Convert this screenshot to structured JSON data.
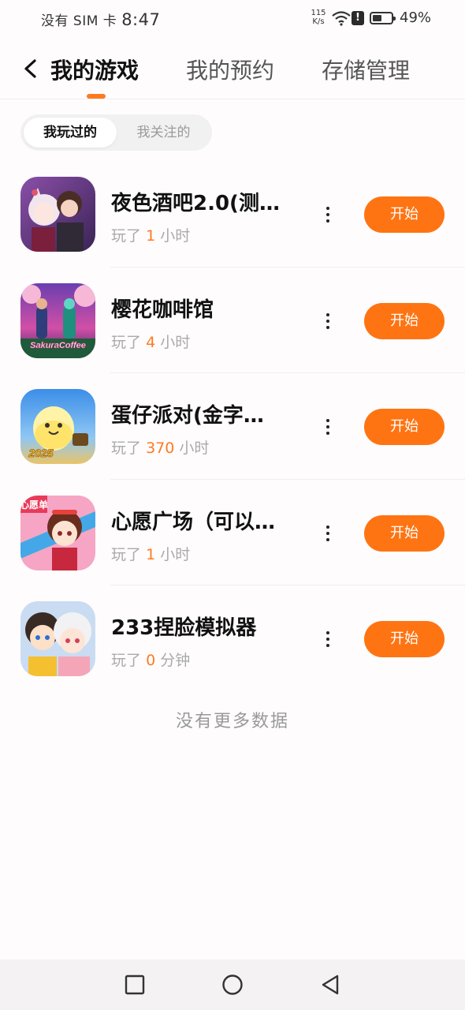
{
  "status_bar": {
    "carrier": "没有 SIM 卡",
    "time": "8:47",
    "speed_value": "115",
    "speed_unit": "K/s",
    "alert_glyph": "!",
    "battery_percent": 49,
    "battery_text": "49%",
    "icons": [
      "wifi-icon",
      "alert-icon",
      "battery-icon"
    ]
  },
  "header": {
    "back_icon": "chevron-left-icon",
    "tabs": [
      {
        "label": "我的游戏",
        "active": true
      },
      {
        "label": "我的预约",
        "active": false
      },
      {
        "label": "存储管理",
        "active": false
      }
    ],
    "accent_color": "#fe7a22"
  },
  "segment": {
    "items": [
      {
        "label": "我玩过的",
        "active": true
      },
      {
        "label": "我关注的",
        "active": false
      }
    ]
  },
  "games": [
    {
      "name": "夜色酒吧2.0(测…",
      "played_prefix": "玩了",
      "played_value": "1",
      "played_unit": "小时",
      "button": "开始",
      "more_icon": "more-vertical-icon"
    },
    {
      "name": "樱花咖啡馆",
      "played_prefix": "玩了",
      "played_value": "4",
      "played_unit": "小时",
      "button": "开始",
      "more_icon": "more-vertical-icon",
      "icon_text": "SakuraCoffee"
    },
    {
      "name": "蛋仔派对(金字…",
      "played_prefix": "玩了",
      "played_value": "370",
      "played_unit": "小时",
      "button": "开始",
      "more_icon": "more-vertical-icon",
      "icon_text": "2025"
    },
    {
      "name": "心愿广场（可以…",
      "played_prefix": "玩了",
      "played_value": "1",
      "played_unit": "小时",
      "button": "开始",
      "more_icon": "more-vertical-icon",
      "icon_text": "心愿单"
    },
    {
      "name": "233捏脸模拟器",
      "played_prefix": "玩了",
      "played_value": "0",
      "played_unit": "分钟",
      "button": "开始",
      "more_icon": "more-vertical-icon"
    }
  ],
  "footer_text": "没有更多数据",
  "nav_bar": {
    "icons": [
      "recents-square-icon",
      "home-circle-icon",
      "back-triangle-icon"
    ]
  },
  "colors": {
    "start_button": "#fe7413",
    "highlight_number": "#fe7a22",
    "secondary_text": "#aaaaaa"
  }
}
